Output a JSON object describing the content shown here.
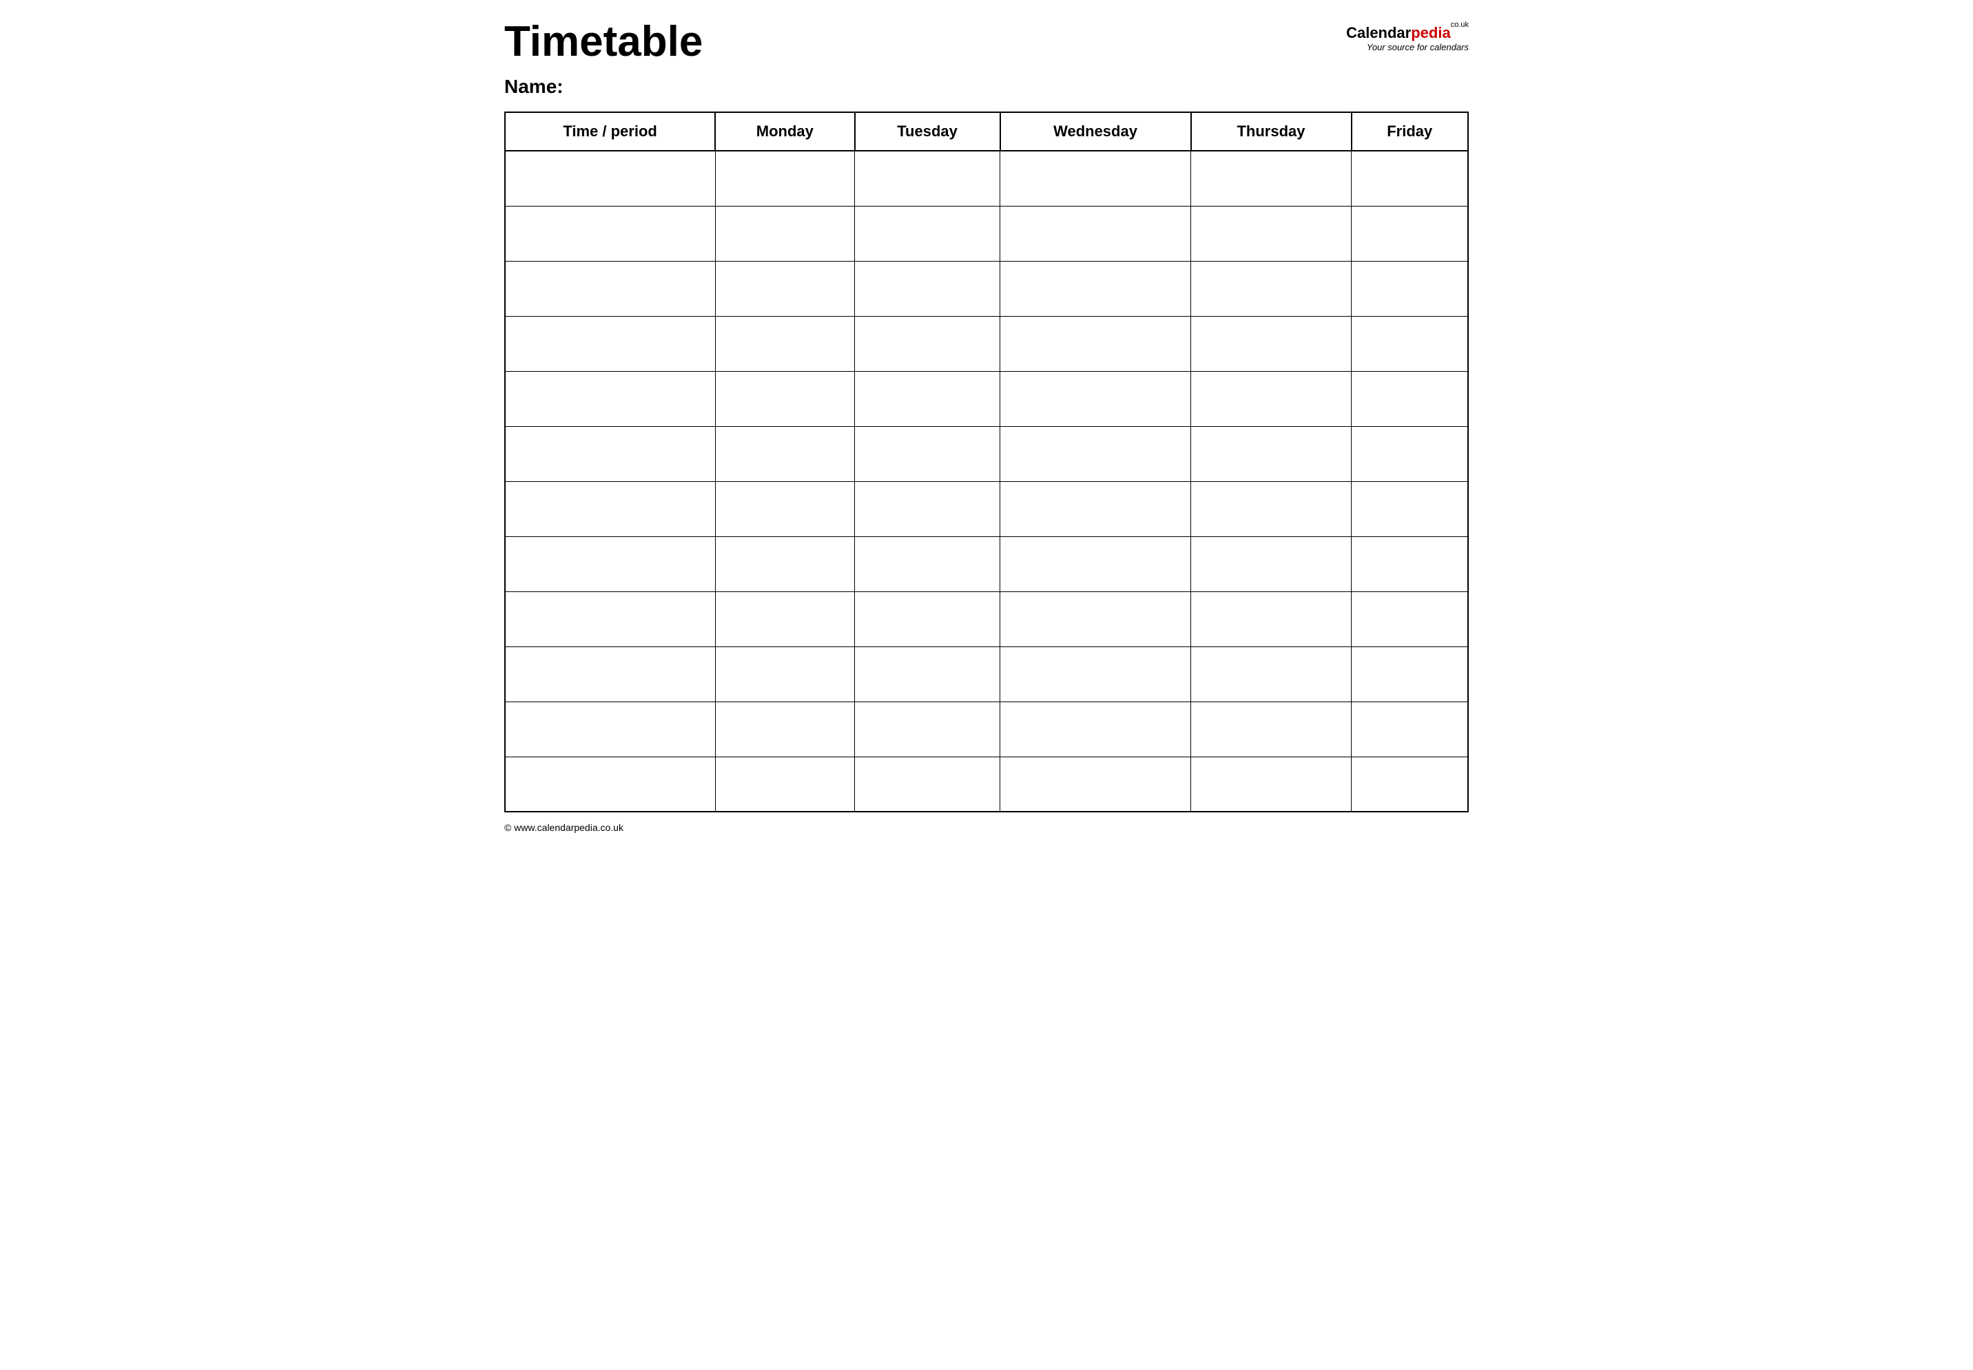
{
  "header": {
    "title": "Timetable",
    "name_label": "Name:",
    "logo": {
      "calendar_part": "Calendar",
      "pedia_part": "pedia",
      "couk": "co.uk",
      "subtitle": "Your source for calendars"
    }
  },
  "table": {
    "columns": [
      {
        "label": "Time / period"
      },
      {
        "label": "Monday"
      },
      {
        "label": "Tuesday"
      },
      {
        "label": "Wednesday"
      },
      {
        "label": "Thursday"
      },
      {
        "label": "Friday"
      }
    ],
    "row_count": 12
  },
  "footer": {
    "url": "© www.calendarpedia.co.uk"
  }
}
